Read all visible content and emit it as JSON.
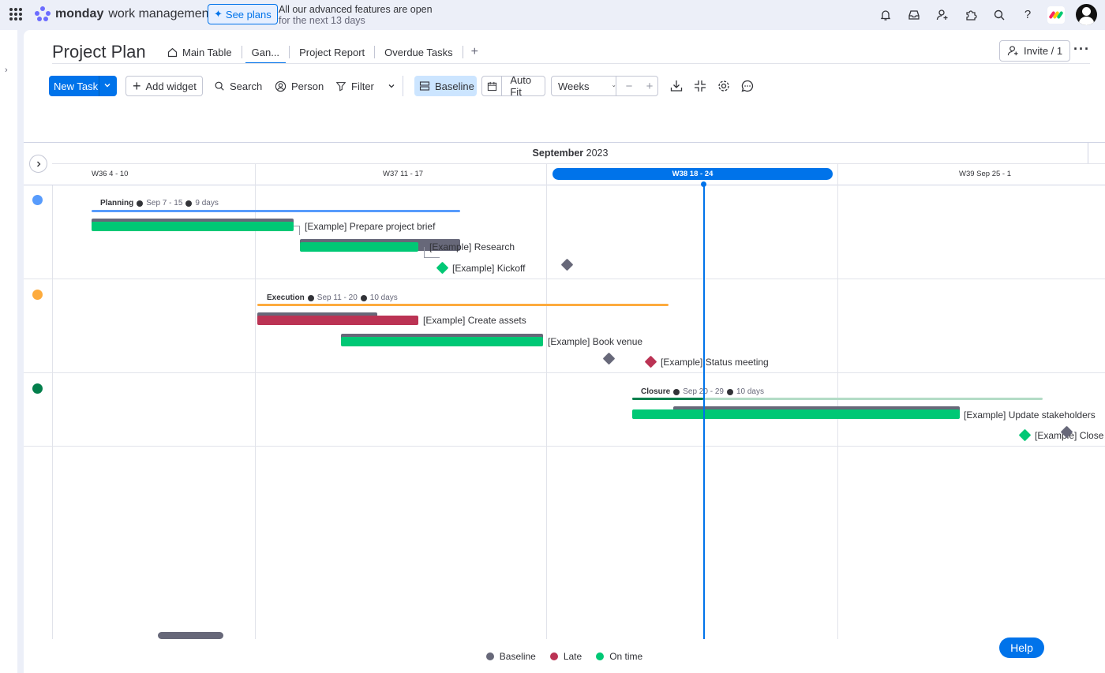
{
  "topbar": {
    "brand_name": "monday",
    "brand_sub": "work management",
    "see_plans": "See plans",
    "trial_line1": "All our advanced features are open",
    "trial_line2": "for the next 13 days"
  },
  "board": {
    "title": "Project Plan",
    "tabs": [
      {
        "label": "Main Table"
      },
      {
        "label": "Gan..."
      },
      {
        "label": "Project Report"
      },
      {
        "label": "Overdue Tasks"
      }
    ],
    "add_tab": "+",
    "invite": "Invite / 1",
    "more": "···"
  },
  "toolbar": {
    "new_task": "New Task",
    "add_widget": "Add widget",
    "search": "Search",
    "person": "Person",
    "filter": "Filter",
    "baseline": "Baseline",
    "auto_fit": "Auto Fit",
    "scale": "Weeks",
    "zoom_out": "−",
    "zoom_in": "+"
  },
  "gantt": {
    "month_bold": "September",
    "month_year": "2023",
    "weeks": [
      "W36 4 - 10",
      "W37 11 - 17",
      "W38 18 - 24",
      "W39 Sep 25 - 1"
    ],
    "groups": [
      {
        "name": "Planning",
        "dates": "Sep 7 - 15",
        "duration": "9 days",
        "color": "#579bfc"
      },
      {
        "name": "Execution",
        "dates": "Sep 11 - 20",
        "duration": "10 days",
        "color": "#fdab3d"
      },
      {
        "name": "Closure",
        "dates": "Sep 20 - 29",
        "duration": "10 days",
        "color": "#037f4c"
      }
    ],
    "tasks": [
      {
        "label": "[Example] Prepare project brief",
        "status": "On time"
      },
      {
        "label": "[Example] Research",
        "status": "On time"
      },
      {
        "label": "[Example] Kickoff",
        "status": "On time"
      },
      {
        "label": "[Example] Create assets",
        "status": "Late"
      },
      {
        "label": "[Example] Book venue",
        "status": "On time"
      },
      {
        "label": "[Example] Status meeting",
        "status": "Late"
      },
      {
        "label": "[Example] Update stakeholders",
        "status": "On time"
      },
      {
        "label": "[Example] Close",
        "status": "On time"
      }
    ]
  },
  "legend": {
    "baseline": "Baseline",
    "late": "Late",
    "on_time": "On time",
    "colors": {
      "baseline": "#676879",
      "late": "#bb3354",
      "on_time": "#00c875"
    }
  },
  "help": "Help",
  "colors": {
    "accent": "#0073ea",
    "on_time": "#00c875",
    "late": "#bb3354",
    "baseline": "#676879"
  }
}
